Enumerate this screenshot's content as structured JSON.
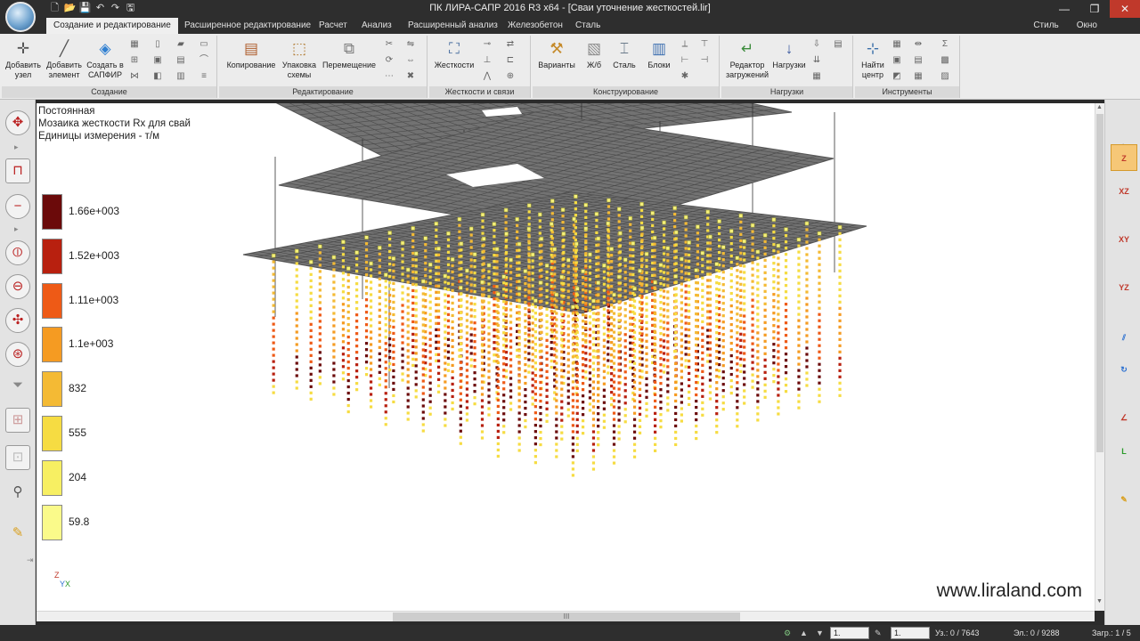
{
  "window": {
    "title": "ПК ЛИРА-САПР  2016 R3 x64 - [Сваи уточнение жесткостей.lir]",
    "controls": [
      "—",
      "❐",
      "✕"
    ]
  },
  "quick_access": [
    "🗋",
    "📂",
    "💾",
    "↶",
    "↷",
    "🖫"
  ],
  "tabs": [
    "Создание и редактирование",
    "Расширенное редактирование",
    "Расчет",
    "Анализ",
    "Расширенный анализ",
    "Железобетон",
    "Сталь"
  ],
  "menu_right": [
    "Стиль",
    "Окно"
  ],
  "ribbon": {
    "groups": {
      "create": {
        "title": "Создание",
        "buttons": [
          "Добавить узел",
          "Добавить элемент",
          "Создать в САПФИР"
        ]
      },
      "edit": {
        "title": "Редактирование",
        "buttons": [
          "Копирование",
          "Упаковка схемы",
          "Перемещение"
        ]
      },
      "stiff": {
        "title": "Жесткости и связи",
        "buttons": [
          "Жесткости"
        ]
      },
      "design": {
        "title": "Конструирование",
        "buttons": [
          "Варианты",
          "Ж/б",
          "Сталь",
          "Блоки"
        ]
      },
      "loads": {
        "title": "Нагрузки",
        "buttons": [
          "Редактор загружений",
          "Нагрузки"
        ]
      },
      "tools": {
        "title": "Инструменты",
        "buttons": [
          "Найти центр"
        ]
      }
    }
  },
  "info": {
    "line1": "Постоянная",
    "line2": "Мозаика жесткости Rx для свай",
    "line3": "Единицы измерения - т/м"
  },
  "legend": [
    {
      "label": "1.66e+003",
      "color": "#6b0a0a"
    },
    {
      "label": "1.52e+003",
      "color": "#b8200f"
    },
    {
      "label": "1.11e+003",
      "color": "#ee5a16"
    },
    {
      "label": "1.1e+003",
      "color": "#f59b22"
    },
    {
      "label": "832",
      "color": "#f4ba34"
    },
    {
      "label": "555",
      "color": "#f6dc42"
    },
    {
      "label": "204",
      "color": "#f7ef62"
    },
    {
      "label": "59.8",
      "color": "#fafa8a"
    }
  ],
  "axis_indicator": {
    "z": "Z",
    "y": "Y",
    "x": "X"
  },
  "watermark": "www.liraland.com",
  "right_tools": [
    "",
    "Z",
    "XZ",
    "XY",
    "YZ",
    "",
    "",
    "",
    "L",
    ""
  ],
  "hscroll_grip": "III",
  "status": {
    "combo1": "1.",
    "combo2": "1.",
    "nodes": "Уз.: 0 / 7643",
    "elements": "Эл.: 0 / 9288",
    "loads": "Загр.: 1 / 5"
  }
}
